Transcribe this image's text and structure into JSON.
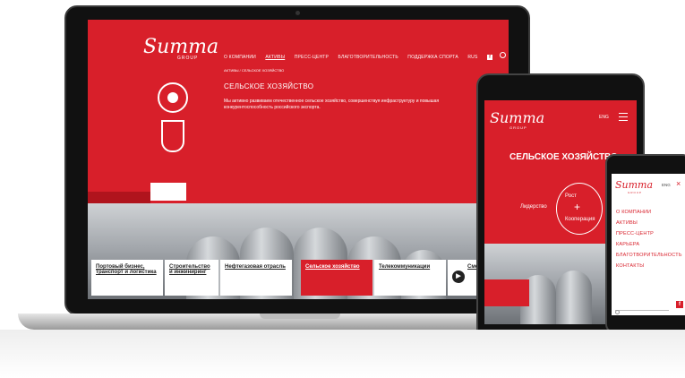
{
  "laptop": {
    "logo_text": "Summa",
    "logo_sub": "GROUP",
    "nav": [
      "О КОМПАНИИ",
      "АКТИВЫ",
      "ПРЕСС-ЦЕНТР",
      "БЛАГОТВОРИТЕЛЬНОСТЬ",
      "ПОДДЕРЖКА СПОРТА",
      "RUS"
    ],
    "breadcrumb": "АКТИВЫ / СЕЛЬСКОЕ ХОЗЯЙСТВО",
    "page_title": "СЕЛЬСКОЕ ХОЗЯЙСТВО",
    "description": "Мы активно развиваем отечественное сельское хозяйство, совершенствуя инфраструктуру и повышая конкурентоспособность российского экспорта.",
    "cards": [
      "Портовый бизнес, транспорт и логистика",
      "Строительство и инжиниринг",
      "Нефтегазовая отрасль",
      "Сельское хозяйство",
      "Телекоммуникации",
      "Сме о н"
    ]
  },
  "tablet": {
    "logo_text": "Summa",
    "logo_sub": "GROUP",
    "lang": "ENG",
    "page_title": "СЕЛЬСКОЕ ХОЗЯЙСТВО",
    "labels": {
      "left": "Лидерство",
      "top": "Рост",
      "bottom": "Кооперация"
    }
  },
  "phone": {
    "logo_text": "Summa",
    "logo_sub": "GROUP",
    "lang": "ENG",
    "menu": [
      "О КОМПАНИИ",
      "АКТИВЫ",
      "ПРЕСС-ЦЕНТР",
      "КАРЬЕРА",
      "БЛАГОТВОРИТЕЛЬНОСТЬ",
      "КОНТАКТЫ"
    ]
  },
  "colors": {
    "brand_red": "#d81f2a"
  }
}
